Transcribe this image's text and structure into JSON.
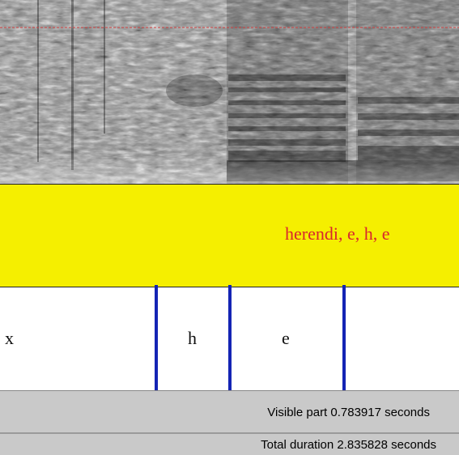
{
  "word_tier": {
    "label": "herendi, e, h, e",
    "label_color": "#d8262e",
    "background": "#f5ef00"
  },
  "phone_tier": {
    "segments": [
      {
        "label": "x"
      },
      {
        "label": "h"
      },
      {
        "label": "e"
      }
    ],
    "boundary_color": "#1424b4"
  },
  "status": {
    "visible_part": "Visible part 0.783917 seconds",
    "total_duration": "Total duration 2.835828 seconds"
  },
  "spectrogram": {
    "cursor_line_color": "#d04040"
  }
}
